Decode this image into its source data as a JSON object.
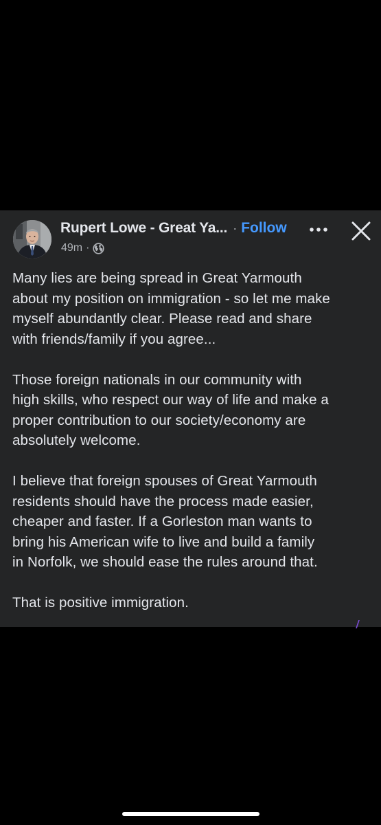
{
  "post": {
    "author": "Rupert Lowe - Great Ya...",
    "separator": "·",
    "follow_label": "Follow",
    "time": "49m",
    "meta_separator": "·",
    "audience_icon": "globe-icon",
    "more_icon": "more-options-icon",
    "close_icon": "close-icon",
    "paragraphs": [
      "Many lies are being spread in Great Yarmouth\nabout my position on immigration - so let me make\nmyself abundantly clear. Please read and share\nwith friends/family if you agree...",
      "Those foreign nationals in our community with\nhigh skills, who respect our way of life and make a\nproper contribution to our society/economy are\nabsolutely welcome.",
      "I believe that foreign spouses of Great Yarmouth\nresidents should have the process made easier,\ncheaper and faster. If a Gorleston man wants to\nbring his American wife to live and build a family\nin Norfolk, we should ease the rules around that.",
      "That is positive immigration."
    ]
  },
  "colors": {
    "background": "#000000",
    "card": "#242526",
    "text": "#e4e6eb",
    "secondary_text": "#b0b3b8",
    "follow": "#4599ff",
    "accent_mark": "#7b4bd6"
  }
}
